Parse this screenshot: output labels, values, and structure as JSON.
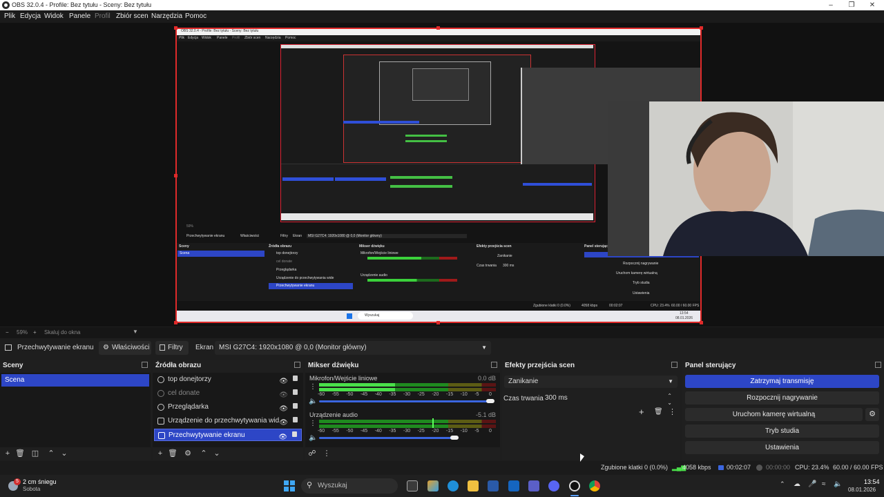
{
  "window": {
    "title": "OBS 32.0.4 - Profile: Bez tytułu - Sceny: Bez tytułu"
  },
  "menu": [
    "Plik",
    "Edycja",
    "Widok",
    "Panele",
    "Profil",
    "Zbiór scen",
    "Narzędzia",
    "Pomoc"
  ],
  "zoom": {
    "value": "59%",
    "minus": "−",
    "plus": "+",
    "fit_label": "Skaluj do okna"
  },
  "source_toolbar": {
    "source_name": "Przechwytywanie ekranu",
    "properties": "Właściwości",
    "filters": "Filtry",
    "screen_label": "Ekran",
    "screen_value": "MSI G27C4: 1920x1080 @ 0,0 (Monitor główny)"
  },
  "scenes": {
    "title": "Sceny",
    "items": [
      "Scena"
    ]
  },
  "sources": {
    "title": "Źródła obrazu",
    "items": [
      {
        "name": "top donejtorzy"
      },
      {
        "name": "cel donate"
      },
      {
        "name": "Przeglądarka"
      },
      {
        "name": "Urządzenie do przechwytywania wide"
      },
      {
        "name": "Przechwytywanie ekranu"
      }
    ]
  },
  "mixer": {
    "title": "Mikser dźwięku",
    "channels": [
      {
        "name": "Mikrofon/Wejście liniowe",
        "db": "0.0 dB",
        "level": 0.75,
        "volume": 1.0
      },
      {
        "name": "Urządzenie audio",
        "db": "-5.1 dB",
        "level": 0.6,
        "volume": 0.8
      }
    ],
    "scale": [
      "-60",
      "-55",
      "-50",
      "-45",
      "-40",
      "-35",
      "-30",
      "-25",
      "-20",
      "-15",
      "-10",
      "-5",
      "0"
    ]
  },
  "transitions": {
    "title": "Efekty przejścia scen",
    "selected": "Zanikanie",
    "duration_label": "Czas trwania",
    "duration_value": "300 ms"
  },
  "controls": {
    "title": "Panel sterujący",
    "buttons": [
      "Zatrzymaj transmisję",
      "Rozpocznij nagrywanie",
      "Uruchom kamerę wirtualną",
      "Tryb studia",
      "Ustawienia"
    ]
  },
  "status": {
    "dropped": "Zgubione klatki 0 (0.0%)",
    "kbps": "4058 kbps",
    "stream_time": "00:02:07",
    "rec_time": "00:00:00",
    "cpu": "CPU: 23.4%",
    "fps": "60.00 / 60.00 FPS"
  },
  "taskbar": {
    "weather_temp": "2 cm śniegu",
    "weather_day": "Sobota",
    "badge": "5",
    "search_placeholder": "Wyszukaj",
    "time": "13:54",
    "date": "08.01.2026"
  },
  "inner_preview": {
    "title": "OBS 32.0.4 - Profile: Bez tytułu - Sceny: Bez tytułu",
    "menu": [
      "Plik",
      "Edycja",
      "Widok",
      "Panele",
      "Profil",
      "Zbiór scen",
      "Narzędzia",
      "Pomoc"
    ],
    "zoom": "59%",
    "source_name": "Przechwytywanie ekranu",
    "properties": "Właściwości",
    "filters": "Filtry",
    "screen_label": "Ekran",
    "screen_value": "MSI G27C4: 1920x1080 @ 0,0 (Monitor główny)",
    "scenes_title": "Sceny",
    "scene": "Scena",
    "sources_title": "Źródła obrazu",
    "mixer_title": "Mikser dźwięku",
    "mic": "Mikrofon/Wejście liniowe",
    "audio": "Urządzenie audio",
    "trans_title": "Efekty przejścia scen",
    "trans_selected": "Zanikanie",
    "duration_label": "Czas trwania",
    "duration_value": "300 ms",
    "controls_title": "Panel sterujący",
    "btn_rec": "Rozpocznij nagrywanie",
    "btn_vcam": "Uruchom kamerę wirtualną",
    "btn_studio": "Tryb studia",
    "btn_settings": "Ustawienia",
    "dropped": "Zgubione klatki 0 (0.0%)",
    "kbps": "4058 kbps",
    "stream_time": "00:02:07",
    "rec_time": "00:00:00",
    "cpu": "CPU: 23.4%",
    "fps": "60.00 / 60.00 FPS",
    "search": "Wyszukaj",
    "time": "13:54",
    "date": "08.01.2026"
  }
}
